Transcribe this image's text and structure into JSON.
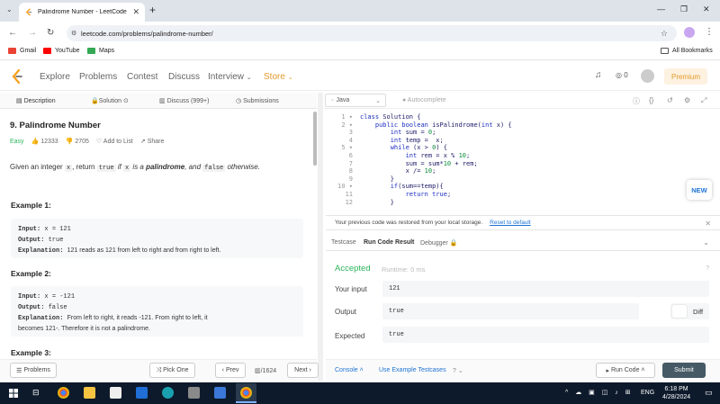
{
  "browser": {
    "tab_title": "Palindrome Number - LeetCode",
    "url": "leetcode.com/problems/palindrome-number/",
    "bookmarks": [
      "Gmail",
      "YouTube",
      "Maps"
    ],
    "all_bookmarks": "All Bookmarks",
    "new_tab_icon": "plus-icon"
  },
  "nav": {
    "links": [
      "Explore",
      "Problems",
      "Contest",
      "Discuss",
      "Interview",
      "Store"
    ],
    "points": "0",
    "premium": "Premium",
    "store_color": "#e49a2b"
  },
  "left_tabs": [
    "Description",
    "Solution",
    "Discuss (999+)",
    "Submissions"
  ],
  "problem": {
    "title": "9. Palindrome Number",
    "difficulty": "Easy",
    "difficulty_color": "#2db55d",
    "likes": "12333",
    "dislikes": "2705",
    "add_to_list": "Add to List",
    "share": "Share",
    "statement_pre": "Given an integer ",
    "statement_x": "x",
    "statement_mid": ", return ",
    "statement_true": "true",
    "statement_if": " if ",
    "statement_x2": "x",
    "statement_is": " is a ",
    "statement_pal": "palindrome",
    "statement_and": ", and ",
    "statement_false": "false",
    "statement_end": " otherwise.",
    "examples": [
      {
        "heading": "Example 1:",
        "input_label": "Input:",
        "input": "x = 121",
        "output_label": "Output:",
        "output": "true",
        "explanation_label": "Explanation:",
        "explanation": "121 reads as 121 from left to right and from right to left."
      },
      {
        "heading": "Example 2:",
        "input_label": "Input:",
        "input": "x = -121",
        "output_label": "Output:",
        "output": "false",
        "explanation_label": "Explanation:",
        "explanation": "From left to right, it reads -121. From right to left, it",
        "explanation2": "becomes 121-. Therefore it is not a palindrome."
      }
    ],
    "example3_heading": "Example 3:"
  },
  "left_footer": {
    "problems": "Problems",
    "pick_one": "Pick One",
    "prev": "Prev",
    "page": "/1624",
    "next": "Next"
  },
  "editor": {
    "language": "Java",
    "autocomplete": "Autocomplete",
    "line_numbers": [
      "1",
      "2",
      "3",
      "4",
      "5",
      "6",
      "7",
      "8",
      "9",
      "10",
      "11",
      "12"
    ],
    "fold_markers": [
      "▾",
      "▾",
      "",
      "",
      "▾",
      "",
      "",
      "",
      "",
      "▾",
      "",
      ""
    ],
    "lines": [
      "class Solution {",
      "    public boolean isPalindrome(int x) {",
      "        int sum = 0;",
      "        int temp =  x;",
      "        while (x > 0) {",
      "            int rem = x % 10;",
      "            sum = sum*10 + rem;",
      "            x /= 10;",
      "        }",
      "        if(sum==temp){",
      "            return true;",
      "        }"
    ],
    "new_badge": "NEW"
  },
  "restore": {
    "message": "Your previous code was restored from your local storage.",
    "reset_link": "Reset to default"
  },
  "result_tabs": [
    "Testcase",
    "Run Code Result",
    "Debugger"
  ],
  "result": {
    "status": "Accepted",
    "status_color": "#2db55d",
    "runtime": "Runtime: 0 ms",
    "your_input_label": "Your input",
    "your_input": "121",
    "output_label": "Output",
    "output": "true",
    "diff": "Diff",
    "expected_label": "Expected",
    "expected": "true"
  },
  "right_footer": {
    "console": "Console",
    "example_testcases": "Use Example Testcases",
    "run_code": "Run Code",
    "submit": "Submit"
  },
  "taskbar": {
    "lang": "ENG",
    "time": "6:18 PM",
    "date": "4/28/2024"
  }
}
